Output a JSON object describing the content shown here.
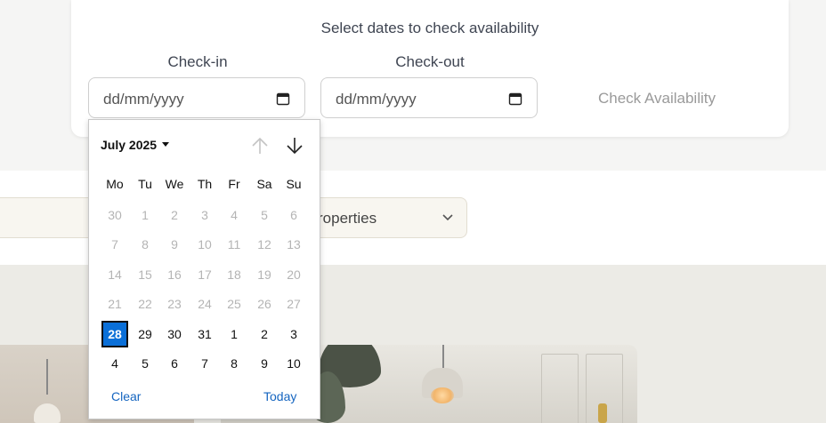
{
  "availability": {
    "title": "Select dates to check availability",
    "checkin_label": "Check-in",
    "checkout_label": "Check-out",
    "checkin_placeholder": "dd/mm/yyyy",
    "checkout_placeholder": "dd/mm/yyyy",
    "check_button": "Check Availability"
  },
  "properties_select": {
    "value": "roperties"
  },
  "datepicker": {
    "month": "July 2025",
    "weekdays": [
      "Mo",
      "Tu",
      "We",
      "Th",
      "Fr",
      "Sa",
      "Su"
    ],
    "weeks": [
      [
        {
          "d": "30",
          "s": "dis"
        },
        {
          "d": "1",
          "s": "dis"
        },
        {
          "d": "2",
          "s": "dis"
        },
        {
          "d": "3",
          "s": "dis"
        },
        {
          "d": "4",
          "s": "dis"
        },
        {
          "d": "5",
          "s": "dis"
        },
        {
          "d": "6",
          "s": "dis"
        }
      ],
      [
        {
          "d": "7",
          "s": "dis"
        },
        {
          "d": "8",
          "s": "dis"
        },
        {
          "d": "9",
          "s": "dis"
        },
        {
          "d": "10",
          "s": "dis"
        },
        {
          "d": "11",
          "s": "dis"
        },
        {
          "d": "12",
          "s": "dis"
        },
        {
          "d": "13",
          "s": "dis"
        }
      ],
      [
        {
          "d": "14",
          "s": "dis"
        },
        {
          "d": "15",
          "s": "dis"
        },
        {
          "d": "16",
          "s": "dis"
        },
        {
          "d": "17",
          "s": "dis"
        },
        {
          "d": "18",
          "s": "dis"
        },
        {
          "d": "19",
          "s": "dis"
        },
        {
          "d": "20",
          "s": "dis"
        }
      ],
      [
        {
          "d": "21",
          "s": "dis"
        },
        {
          "d": "22",
          "s": "dis"
        },
        {
          "d": "23",
          "s": "dis"
        },
        {
          "d": "24",
          "s": "dis"
        },
        {
          "d": "25",
          "s": "dis"
        },
        {
          "d": "26",
          "s": "dis"
        },
        {
          "d": "27",
          "s": "dis"
        }
      ],
      [
        {
          "d": "28",
          "s": "sel"
        },
        {
          "d": "29",
          "s": "en"
        },
        {
          "d": "30",
          "s": "en"
        },
        {
          "d": "31",
          "s": "en"
        },
        {
          "d": "1",
          "s": "en"
        },
        {
          "d": "2",
          "s": "en"
        },
        {
          "d": "3",
          "s": "en"
        }
      ],
      [
        {
          "d": "4",
          "s": "en"
        },
        {
          "d": "5",
          "s": "en"
        },
        {
          "d": "6",
          "s": "en"
        },
        {
          "d": "7",
          "s": "en"
        },
        {
          "d": "8",
          "s": "en"
        },
        {
          "d": "9",
          "s": "en"
        },
        {
          "d": "10",
          "s": "en"
        }
      ]
    ],
    "clear_label": "Clear",
    "today_label": "Today"
  },
  "colors": {
    "accent": "#0a6fd8",
    "link": "#1565c0",
    "disabled": "#b4b4b4"
  },
  "icons": {
    "calendar": "calendar-icon",
    "up": "arrow-up-icon",
    "down": "arrow-down-icon",
    "chevron": "chevron-down-icon"
  }
}
